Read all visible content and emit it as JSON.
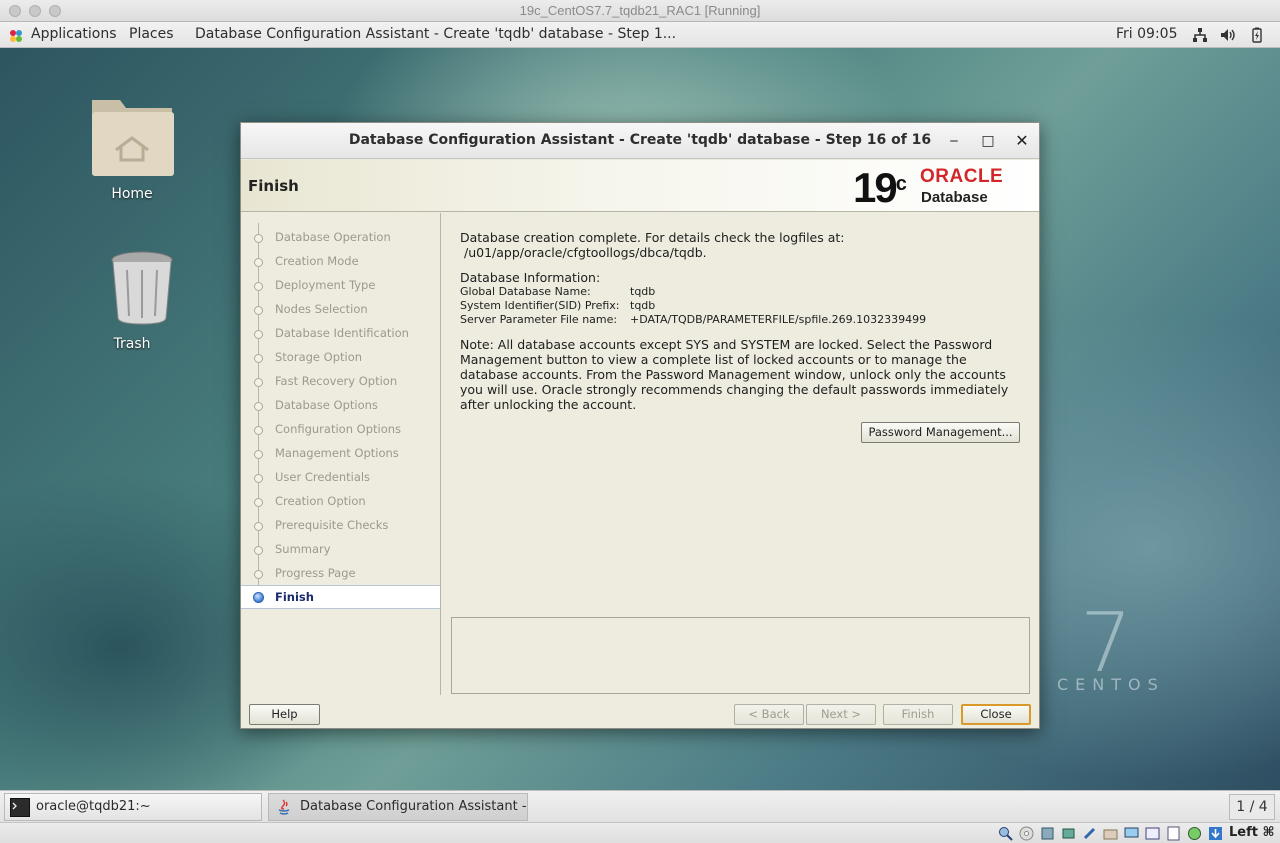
{
  "host_window": {
    "title": "19c_CentOS7.7_tqdb21_RAC1 [Running]"
  },
  "top_panel": {
    "applications": "Applications",
    "places": "Places",
    "active_window": "Database Configuration Assistant - Create 'tqdb' database - Step 1...",
    "clock": "Fri 09:05"
  },
  "desktop": {
    "icons": [
      {
        "label": "Home"
      },
      {
        "label": "Trash"
      }
    ],
    "wallpaper_number": "7",
    "wallpaper_word": "CENTOS"
  },
  "dialog": {
    "title": "Database Configuration Assistant - Create 'tqdb' database - Step 16 of 16",
    "step_title": "Finish",
    "brand": {
      "version": "19",
      "version_sup": "c",
      "vendor": "ORACLE",
      "product": "Database"
    },
    "steps": [
      "Database Operation",
      "Creation Mode",
      "Deployment Type",
      "Nodes Selection",
      "Database Identification",
      "Storage Option",
      "Fast Recovery Option",
      "Database Options",
      "Configuration Options",
      "Management Options",
      "User Credentials",
      "Creation Option",
      "Prerequisite Checks",
      "Summary",
      "Progress Page",
      "Finish"
    ],
    "active_step": "Finish",
    "content": {
      "completion_line1": "Database creation complete. For details check the logfiles at:",
      "completion_line2": " /u01/app/oracle/cfgtoollogs/dbca/tqdb.",
      "info_heading": "Database Information:",
      "info": [
        {
          "key": "Global Database Name:",
          "value": "tqdb"
        },
        {
          "key": "System Identifier(SID) Prefix:",
          "value": "tqdb"
        },
        {
          "key": "Server Parameter File name:",
          "value": "+DATA/TQDB/PARAMETERFILE/spfile.269.1032339499"
        }
      ],
      "note_lines": [
        "Note: All database accounts except SYS and SYSTEM are locked. Select the Password",
        "Management button to view a complete list of locked accounts or to manage the",
        "database accounts. From the Password Management window, unlock only the accounts",
        "you will use. Oracle strongly recommends changing the default passwords immediately",
        "after unlocking the account."
      ]
    },
    "buttons": {
      "password_management": "Password Management...",
      "help": "Help",
      "back": "< Back",
      "next": "Next >",
      "finish": "Finish",
      "close": "Close"
    }
  },
  "taskbar": {
    "tasks": [
      {
        "label": "oracle@tqdb21:~"
      },
      {
        "label": "Database Configuration Assistant - C..."
      }
    ],
    "workspace": "1 / 4"
  },
  "vbox_status": {
    "host_key": "Left ⌘"
  },
  "colors": {
    "oracle_red": "#d2262b",
    "default_button_border": "#d99a2b",
    "active_step_text": "#1b2b6e"
  }
}
